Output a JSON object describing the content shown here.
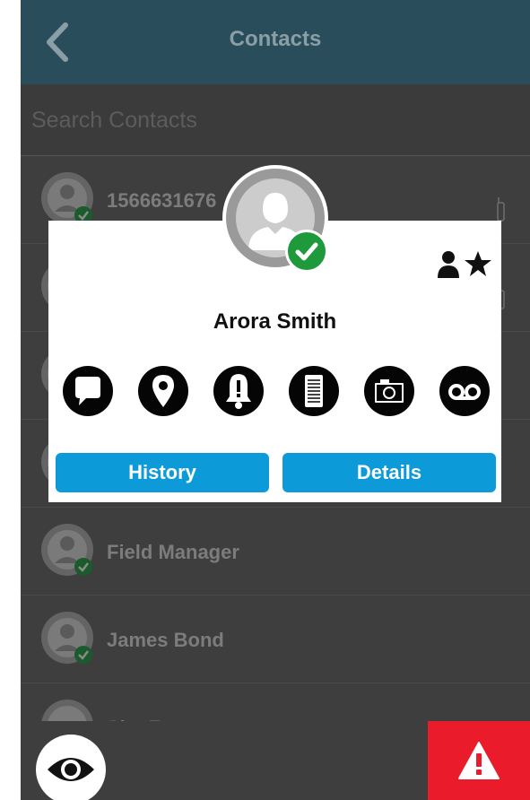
{
  "header": {
    "title": "Contacts",
    "back_icon": "chevron-left-icon"
  },
  "search": {
    "placeholder": "Search Contacts",
    "value": ""
  },
  "contacts": [
    {
      "name": "1566631676",
      "status": "online"
    },
    {
      "name": "",
      "status": "online"
    },
    {
      "name": "",
      "status": "online"
    },
    {
      "name": "",
      "status": "online"
    },
    {
      "name": "Field Manager",
      "status": "online"
    },
    {
      "name": "James Bond",
      "status": "online"
    },
    {
      "name": "Site F",
      "status": "online"
    }
  ],
  "modal": {
    "name": "Arora Smith",
    "status": "online",
    "favorite_icon": "person-star-icon",
    "actions": [
      {
        "icon": "message-icon"
      },
      {
        "icon": "location-icon"
      },
      {
        "icon": "alert-bell-icon"
      },
      {
        "icon": "document-icon"
      },
      {
        "icon": "camera-icon"
      },
      {
        "icon": "voicemail-icon"
      }
    ],
    "history_label": "History",
    "details_label": "Details"
  },
  "bottom": {
    "view_icon": "eye-icon",
    "emergency_icon": "warning-icon"
  },
  "colors": {
    "header": "#2a4d5c",
    "background": "#3e3e3e",
    "status_online": "#1e9a3c",
    "accent_button": "#0d9ad8",
    "emergency": "#ea1b2a"
  }
}
